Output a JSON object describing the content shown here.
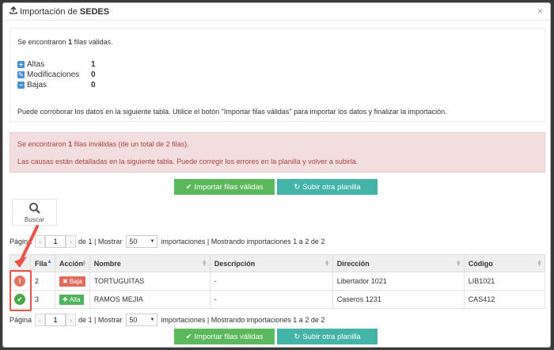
{
  "header": {
    "title_prefix": "Importación de",
    "title_bold": "SEDES",
    "close": "×"
  },
  "valid": {
    "summary_pre": "Se encontraron",
    "summary_count": "1",
    "summary_post": "filas válidas.",
    "counts": [
      {
        "icon": "+",
        "label": "Altas",
        "value": "1",
        "color": "#4a90d9"
      },
      {
        "icon": "✎",
        "label": "Modificaciones",
        "value": "0",
        "color": "#4a90d9"
      },
      {
        "icon": "−",
        "label": "Bajas",
        "value": "0",
        "color": "#4a90d9"
      }
    ],
    "note": "Puede corroborar los datos en la siguiente tabla. Utilice el botón \"Importar filas válidas\" para importar los datos y finalizar la importación."
  },
  "invalid": {
    "line1_pre": "Se encontraron",
    "line1_count": "1",
    "line1_post": "filas inválidas (de un total de 2 filas).",
    "line2": "Las causas están detalladas en la siguiente tabla. Puede corregir los errores en la planilla y volver a subirla."
  },
  "buttons": {
    "import": "Importar filas válidas",
    "upload": "Subir otra planilla"
  },
  "search": {
    "label": "Buscar"
  },
  "pager": {
    "page_label": "Página",
    "page_value": "1",
    "of_text": "de 1 | Mostrar",
    "per_page": "50",
    "info": "importaciones | Mostrando importaciones 1 a 2 de 2"
  },
  "table": {
    "columns": [
      "Fila",
      "Acción",
      "Nombre",
      "Descripción",
      "Dirección",
      "Código"
    ],
    "rows": [
      {
        "status": "warning",
        "fila": "2",
        "accion": "Baja",
        "nombre": "TORTUGUITAS",
        "descripcion": "-",
        "direccion": "Libertador 1021",
        "codigo": "LIB1021"
      },
      {
        "status": "ok",
        "fila": "3",
        "accion": "Alta",
        "nombre": "RAMOS MEJIA",
        "descripcion": "-",
        "direccion": "Caseros 1231",
        "codigo": "CAS412"
      }
    ]
  },
  "colors": {
    "green": "#5cb85c",
    "teal": "#44b3a8",
    "error_bg": "#f2dede",
    "error_text": "#a94442",
    "highlight": "#e9544a"
  }
}
